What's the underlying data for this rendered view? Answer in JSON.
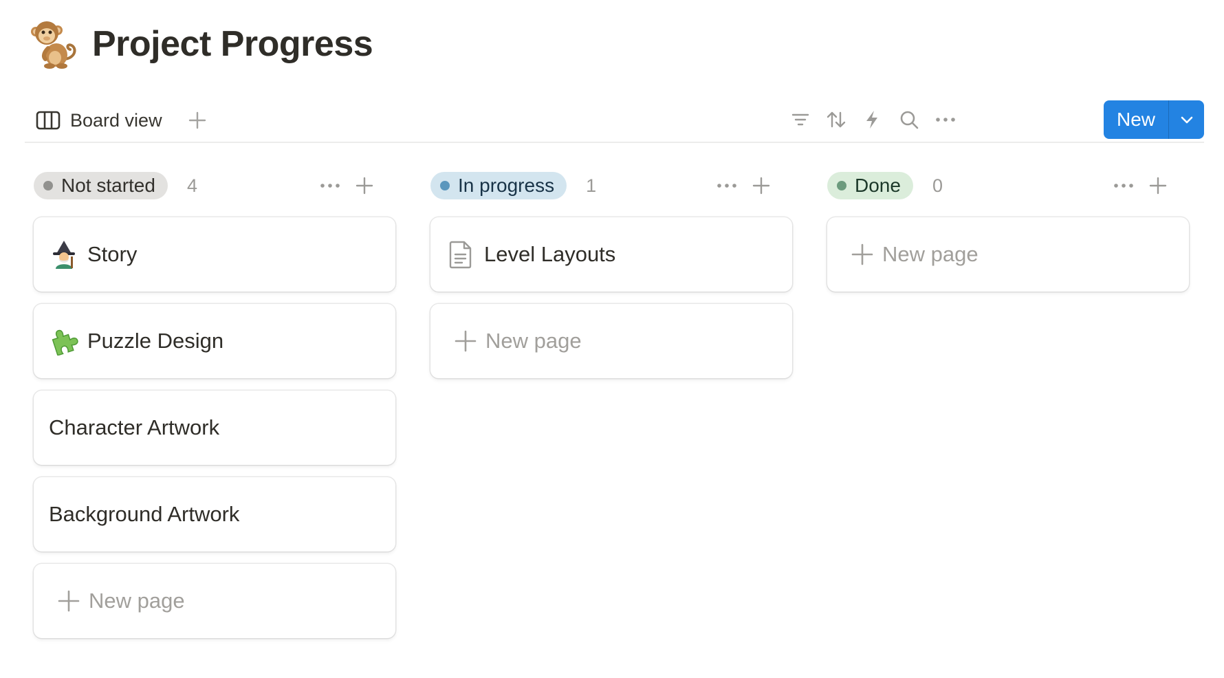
{
  "page": {
    "title": "Project Progress",
    "icon": "monkey-emoji"
  },
  "toolbar": {
    "view_label": "Board view",
    "icons": [
      "board-view-icon",
      "add-view-icon",
      "filter-icon",
      "sort-icon",
      "automation-icon",
      "search-icon",
      "more-icon",
      "chevron-down-icon"
    ],
    "new_label": "New",
    "accent": "#2383e2"
  },
  "columns": [
    {
      "status": "Not started",
      "count": "4",
      "pill_bg": "#e3e2e0",
      "dot": "#91918e",
      "text": "#32302c",
      "cards": [
        {
          "title": "Story",
          "icon": "wizard-emoji"
        },
        {
          "title": "Puzzle Design",
          "icon": "puzzle-piece-emoji"
        },
        {
          "title": "Character Artwork",
          "icon": ""
        },
        {
          "title": "Background Artwork",
          "icon": ""
        }
      ],
      "new_page": "New page"
    },
    {
      "status": "In progress",
      "count": "1",
      "pill_bg": "#d3e5ef",
      "dot": "#5b97bd",
      "text": "#183347",
      "cards": [
        {
          "title": "Level Layouts",
          "icon": "document-icon"
        }
      ],
      "new_page": "New page"
    },
    {
      "status": "Done",
      "count": "0",
      "pill_bg": "#dbeddb",
      "dot": "#6c9b7d",
      "text": "#1c3829",
      "cards": [],
      "new_page": "New page"
    }
  ]
}
